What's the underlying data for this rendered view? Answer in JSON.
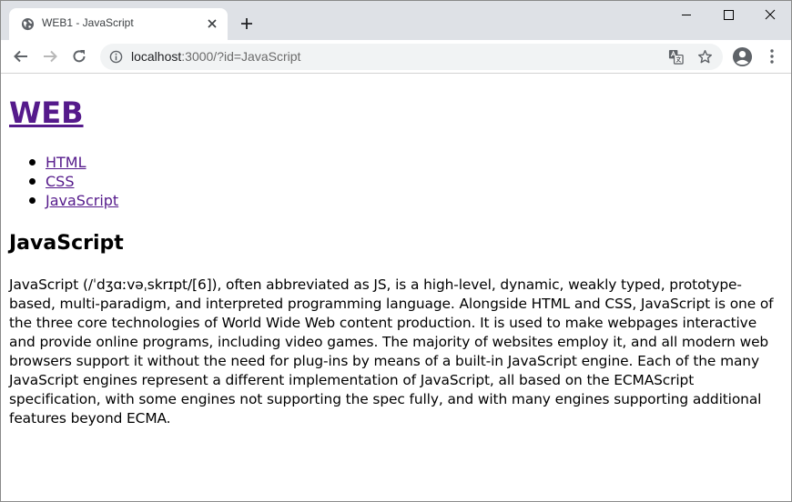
{
  "browser": {
    "tab": {
      "title": "WEB1 - JavaScript",
      "favicon": "globe-icon"
    },
    "url": {
      "host": "localhost",
      "path": ":3000/?id=JavaScript"
    },
    "icons": [
      "back-arrow-icon",
      "forward-arrow-icon",
      "reload-icon",
      "info-icon",
      "translate-icon",
      "star-icon",
      "profile-icon",
      "menu-dots-icon"
    ]
  },
  "page": {
    "site_title": "WEB",
    "nav": [
      {
        "label": "HTML"
      },
      {
        "label": "CSS"
      },
      {
        "label": "JavaScript"
      }
    ],
    "heading": "JavaScript",
    "description": "JavaScript (/ˈdʒɑːvəˌskrɪpt/[6]), often abbreviated as JS, is a high-level, dynamic, weakly typed, prototype-based, multi-paradigm, and interpreted programming language. Alongside HTML and CSS, JavaScript is one of the three core technologies of World Wide Web content production. It is used to make webpages interactive and provide online programs, including video games. The majority of websites employ it, and all modern web browsers support it without the need for plug-ins by means of a built-in JavaScript engine. Each of the many JavaScript engines represent a different implementation of JavaScript, all based on the ECMAScript specification, with some engines not supporting the spec fully, and with many engines supporting additional features beyond ECMA."
  },
  "colors": {
    "link_visited": "#551a8b",
    "tabstrip": "#dee1e6",
    "omnibox": "#f1f3f4"
  }
}
